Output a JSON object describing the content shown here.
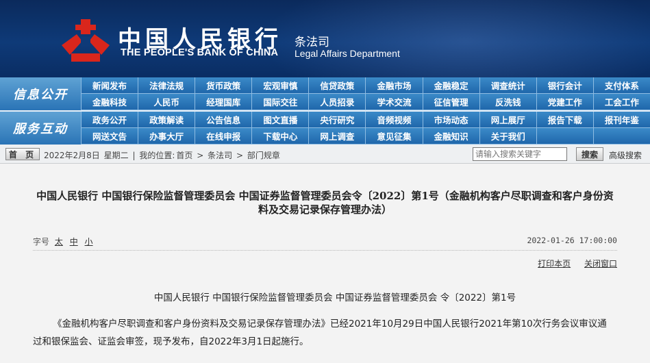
{
  "header": {
    "bank_name_cn": "中国人民银行",
    "bank_name_en": "THE PEOPLE'S BANK OF CHINA",
    "dept_cn": "条法司",
    "dept_en": "Legal Affairs Department",
    "logo_icon": "pboc-logo-icon",
    "logo_color": "#d9261c"
  },
  "nav": {
    "section1_label": "信息公开",
    "section2_label": "服务互动",
    "row1": [
      "新闻发布",
      "法律法规",
      "货币政策",
      "宏观审慎",
      "信贷政策",
      "金融市场",
      "金融稳定",
      "调查统计",
      "银行会计",
      "支付体系"
    ],
    "row2": [
      "金融科技",
      "人民币",
      "经理国库",
      "国际交往",
      "人员招录",
      "学术交流",
      "征信管理",
      "反洗钱",
      "党建工作",
      "工会工作"
    ],
    "row3": [
      "政务公开",
      "政策解读",
      "公告信息",
      "图文直播",
      "央行研究",
      "音频视频",
      "市场动态",
      "网上展厅",
      "报告下载",
      "报刊年鉴"
    ],
    "row4": [
      "网送文告",
      "办事大厅",
      "在线申报",
      "下载中心",
      "网上调查",
      "意见征集",
      "金融知识",
      "关于我们",
      "",
      ""
    ],
    "accent_color": "#2a74b6"
  },
  "crumbbar": {
    "home_label": "首 页",
    "date": "2022年2月8日",
    "weekday": "星期二",
    "sep": "|",
    "location_label": "我的位置:",
    "crumbs": [
      "首页",
      "条法司",
      "部门规章"
    ],
    "crumb_sep": ">",
    "search_placeholder": "请输入搜索关键字",
    "search_button": "搜索",
    "advanced_search": "高级搜索"
  },
  "article": {
    "title_line1": "中国人民银行  中国银行保险监督管理委员会  中国证券监督管理委员会令〔2022〕第1号（金融机构客户尽职调查和客户身份资",
    "title_line2": "料及交易记录保存管理办法）",
    "font_size_label": "字号",
    "font_sizes": [
      "太",
      "中",
      "小"
    ],
    "publish_time": "2022-01-26 17:00:00",
    "print_label": "打印本页",
    "close_label": "关闭窗口",
    "order_line": "中国人民银行  中国银行保险监督管理委员会  中国证券监督管理委员会  令〔2022〕第1号",
    "para_line1": "《金融机构客户尽职调查和客户身份资料及交易记录保存管理办法》已经2021年10月29日中国人民银行2021年第10次行务会议审议通",
    "para_line2": "过和银保监会、证监会审签，现予发布，自2022年3月1日起施行。"
  }
}
